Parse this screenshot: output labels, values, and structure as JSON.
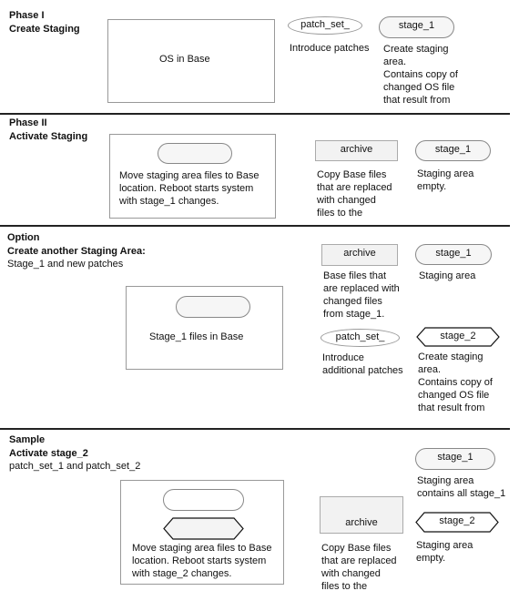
{
  "sections": [
    {
      "heading": [
        "Phase I",
        "Create Staging"
      ],
      "subtitle": "",
      "base_box": {
        "text": "OS in Base"
      },
      "patch": {
        "label": "patch_set_",
        "desc": [
          "Introduce patches"
        ]
      },
      "stage1": {
        "label": "stage_1",
        "desc": [
          "Create staging",
          "area.",
          "Contains copy of",
          "changed OS file",
          "that result from"
        ]
      }
    },
    {
      "heading": [
        "Phase II",
        "Activate Staging"
      ],
      "subtitle": "",
      "base_box": {
        "text": [
          "Move staging area files to Base",
          "location. Reboot starts system",
          "with stage_1 changes."
        ]
      },
      "archive": {
        "label": "archive",
        "desc": [
          "Copy Base files",
          "that are replaced",
          "with changed",
          "files to the"
        ]
      },
      "stage1": {
        "label": "stage_1",
        "desc": [
          "Staging area",
          "empty."
        ]
      }
    },
    {
      "heading": [
        "Option",
        "Create another Staging Area:"
      ],
      "subtitle": "Stage_1 and new patches",
      "base_box": {
        "text": "Stage_1 files in Base"
      },
      "archive": {
        "label": "archive",
        "desc": [
          "Base files that",
          "are replaced with",
          "changed files",
          "from stage_1."
        ]
      },
      "stage1": {
        "label": "stage_1",
        "desc": [
          "Staging area"
        ]
      },
      "patch": {
        "label": "patch_set_",
        "desc": [
          "Introduce",
          "additional patches"
        ]
      },
      "stage2": {
        "label": "stage_2",
        "desc": [
          "Create staging",
          "area.",
          "Contains copy of",
          "changed OS file",
          "that result from"
        ]
      }
    },
    {
      "heading": [
        "Sample",
        "Activate stage_2"
      ],
      "subtitle": "patch_set_1 and patch_set_2",
      "base_box": {
        "text": [
          "Move staging area files to Base",
          "location. Reboot starts system",
          "with stage_2 changes."
        ]
      },
      "archive": {
        "label": "archive",
        "desc": [
          "Copy Base files",
          "that are replaced",
          "with changed",
          "files to the"
        ]
      },
      "stage1": {
        "label": "stage_1",
        "desc": [
          "Staging area",
          "contains all stage_1"
        ]
      },
      "stage2": {
        "label": "stage_2",
        "desc": [
          "Staging area",
          "empty."
        ]
      }
    }
  ]
}
